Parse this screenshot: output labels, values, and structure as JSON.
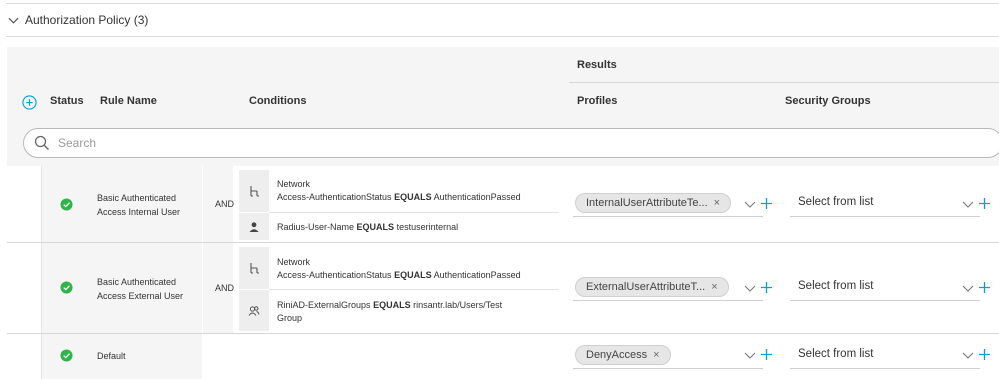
{
  "section": {
    "title": "Authorization Policy (3)"
  },
  "header": {
    "results": "Results",
    "status": "Status",
    "rule_name": "Rule Name",
    "conditions": "Conditions",
    "profiles": "Profiles",
    "security_groups": "Security Groups"
  },
  "search": {
    "placeholder": "Search"
  },
  "rules": [
    {
      "name_line1": "Basic Authenticated",
      "name_line2": "Access Internal User",
      "operator": "AND",
      "cond1": {
        "line1": "Network",
        "attr": "Access-AuthenticationStatus",
        "op": "EQUALS",
        "value": "AuthenticationPassed"
      },
      "cond2": {
        "attr": "Radius-User-Name",
        "op": "EQUALS",
        "value": "testuserinternal"
      },
      "profile": "InternalUserAttributeTe...",
      "security_group": "Select from list"
    },
    {
      "name_line1": "Basic Authenticated",
      "name_line2": "Access External User",
      "operator": "AND",
      "cond1": {
        "line1": "Network",
        "attr": "Access-AuthenticationStatus",
        "op": "EQUALS",
        "value": "AuthenticationPassed"
      },
      "cond2": {
        "attr": "RiniAD-ExternalGroups",
        "op": "EQUALS",
        "value": "rinsantr.lab/Users/Test",
        "line2": "Group"
      },
      "profile": "ExternalUserAttributeT...",
      "security_group": "Select from list"
    },
    {
      "name_line1": "Default",
      "profile": "DenyAccess",
      "security_group": "Select from list"
    }
  ],
  "icons": {
    "status": "check-circle-icon",
    "network_condition": "network-tree-icon",
    "user_condition": "user-icon",
    "group_condition": "group-users-icon"
  },
  "colors": {
    "accent": "#049fd9",
    "success": "#2fb44a"
  }
}
